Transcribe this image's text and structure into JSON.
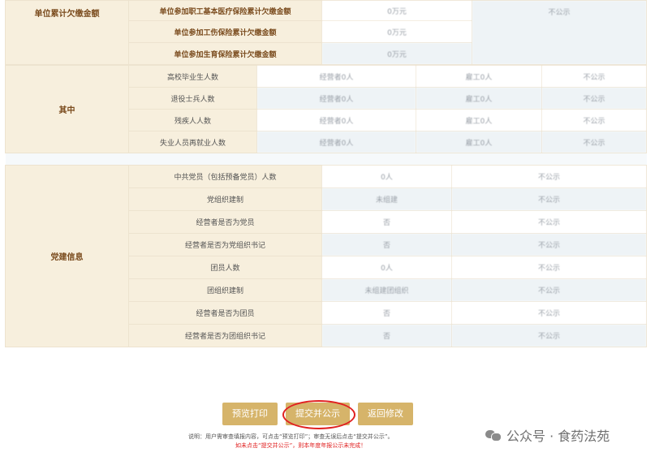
{
  "arrears": {
    "group": "单位累计欠缴金额",
    "rows": [
      {
        "label": "单位参加职工基本医疗保险累计欠缴金额",
        "value": "0万元",
        "aside": "不公示"
      },
      {
        "label": "单位参加工伤保险累计欠缴金额",
        "value": "0万元"
      },
      {
        "label": "单位参加生育保险累计欠缴金额",
        "value": "0万元"
      }
    ]
  },
  "among": {
    "group": "其中",
    "rows": [
      {
        "label": "高校毕业生人数",
        "c1": "经营者0人",
        "c2": "雇工0人",
        "c3": "不公示"
      },
      {
        "label": "退役士兵人数",
        "c1": "经营者0人",
        "c2": "雇工0人",
        "c3": "不公示"
      },
      {
        "label": "残疾人人数",
        "c1": "经营者0人",
        "c2": "雇工0人",
        "c3": "不公示"
      },
      {
        "label": "失业人员再就业人数",
        "c1": "经营者0人",
        "c2": "雇工0人",
        "c3": "不公示"
      }
    ]
  },
  "party": {
    "group": "党建信息",
    "rows": [
      {
        "label": "中共党员（包括预备党员）人数",
        "value": "0人",
        "aside": "不公示"
      },
      {
        "label": "党组织建制",
        "value": "未组建",
        "aside": "不公示"
      },
      {
        "label": "经营者是否为党员",
        "value": "否",
        "aside": "不公示"
      },
      {
        "label": "经营者是否为党组织书记",
        "value": "否",
        "aside": "不公示"
      },
      {
        "label": "团员人数",
        "value": "0人",
        "aside": "不公示"
      },
      {
        "label": "团组织建制",
        "value": "未组建团组织",
        "aside": "不公示"
      },
      {
        "label": "经营者是否为团员",
        "value": "否",
        "aside": "不公示"
      },
      {
        "label": "经营者是否为团组织书记",
        "value": "否",
        "aside": "不公示"
      }
    ]
  },
  "buttons": {
    "preview": "预览打印",
    "submit": "提交并公示",
    "back": "返回修改"
  },
  "notes": {
    "line1": "说明：用户需审查填报内容，可点击“预览打印”；审查无误后点击“提交并公示”。",
    "line2": "如未点击“提交并公示”，则本年度年报公示未完成！"
  },
  "watermark": {
    "text": "公众号 · 食药法苑",
    "icon": "wechat-icon"
  },
  "colors": {
    "header_bg": "#f7efdd",
    "header_text": "#7a4b1d",
    "button": "#d6b46a",
    "highlight": "#e02020"
  }
}
